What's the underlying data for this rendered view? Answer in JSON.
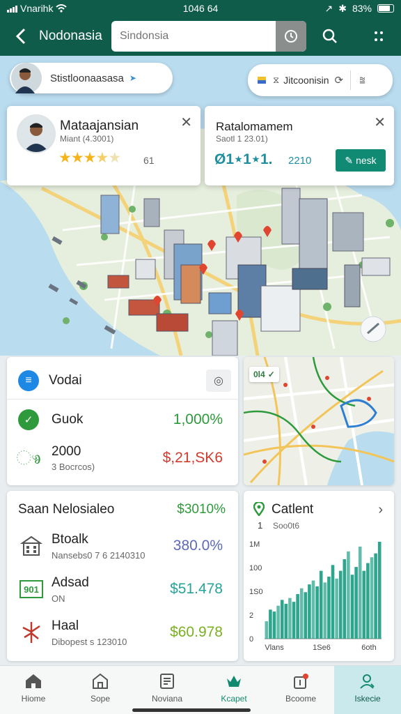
{
  "status": {
    "carrier": "Vnarihk",
    "time": "1046 64",
    "battery": "83%"
  },
  "header": {
    "title": "Nodonasia",
    "search_placeholder": "Sindonsia"
  },
  "map_chip": {
    "label": "Stistloonaasasa"
  },
  "map_pill": {
    "label": "Jitcoonisin"
  },
  "card_left": {
    "title": "Mataajansian",
    "subtitle": "Miant (4.3001)",
    "rating": 3.5,
    "rating_value": "61"
  },
  "card_right": {
    "title": "Ratalomamem",
    "subtitle": "Saotl 1 23.01)",
    "code": "Ø1⋆1⋆1.",
    "value": "2210",
    "button": "nesk"
  },
  "panel_a": {
    "title": "Vodai",
    "rows": [
      {
        "label": "Guok",
        "value": "1,000%"
      },
      {
        "label": "2000",
        "sub": "3 Bocrcos)",
        "value": "$,21,SK6"
      }
    ]
  },
  "mini_map": {
    "tag": "0l4"
  },
  "panel_b": {
    "title": "Saan Nelosialeo",
    "title_value": "$3010%",
    "rows": [
      {
        "label": "Btoalk",
        "sub": "Nansebs0 7 6 2140310",
        "value": "380.0%"
      },
      {
        "label": "Adsad",
        "sub": "ON",
        "value": "$51.478"
      },
      {
        "label": "Haal",
        "sub": "Dibopest s 123010",
        "value": "$60.978"
      }
    ],
    "box_icon_text": "901"
  },
  "chart_panel": {
    "title": "Catlent",
    "sub_index": "1",
    "sub": "Soo0t6"
  },
  "chart_data": {
    "type": "bar",
    "title": "Catlent",
    "ytick_labels": [
      "1M",
      "100",
      "1S0",
      "2",
      "0"
    ],
    "xtick_labels": [
      "Vlans",
      "1Se6",
      "6oth"
    ],
    "values": [
      18,
      30,
      28,
      34,
      40,
      36,
      42,
      38,
      46,
      52,
      48,
      56,
      60,
      54,
      70,
      58,
      64,
      76,
      62,
      70,
      82,
      90,
      66,
      74,
      95,
      70,
      78,
      84,
      88,
      100
    ],
    "color": "#2ea58d",
    "ylim": [
      0,
      105
    ]
  },
  "nav": [
    {
      "label": "Hiome",
      "icon": "home-icon"
    },
    {
      "label": "Sope",
      "icon": "store-icon"
    },
    {
      "label": "Noviana",
      "icon": "list-icon"
    },
    {
      "label": "Kcapet",
      "icon": "crown-icon"
    },
    {
      "label": "Bcoome",
      "icon": "notification-icon"
    },
    {
      "label": "Iskecie",
      "icon": "profile-icon"
    }
  ],
  "colors": {
    "header": "#0f5c4a",
    "accent": "#17a08a",
    "green": "#2e9a3c",
    "red": "#d23b2e"
  }
}
